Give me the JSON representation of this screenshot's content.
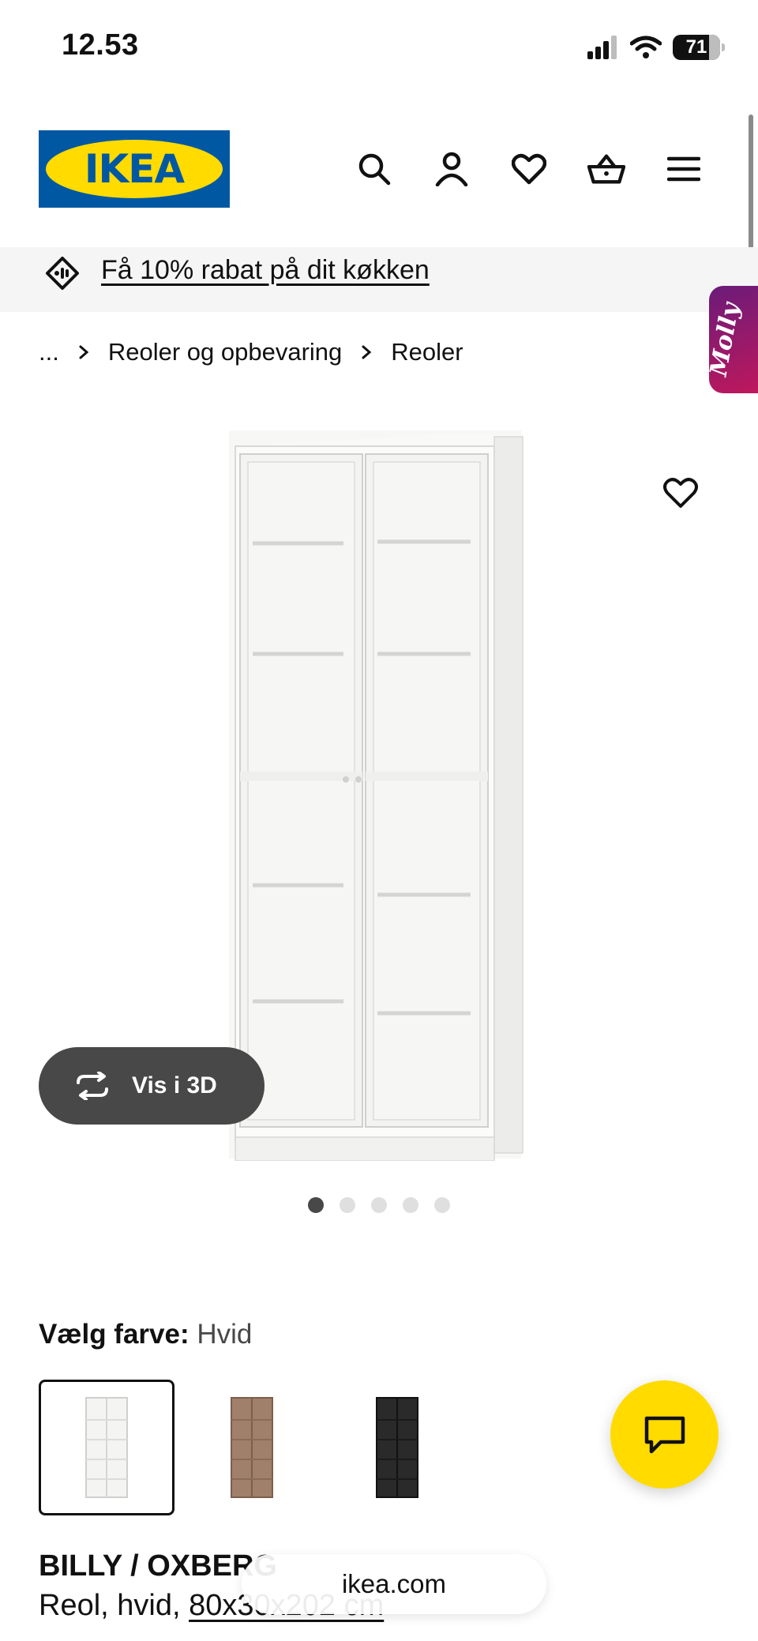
{
  "status_bar": {
    "time": "12.53",
    "battery": "71"
  },
  "header": {
    "logo_text": "IKEA",
    "icons": [
      "search-icon",
      "profile-icon",
      "heart-icon",
      "basket-icon",
      "menu-icon"
    ]
  },
  "promo": {
    "text": "Få 10% rabat på dit køkken"
  },
  "molly": {
    "label": "Molly"
  },
  "breadcrumb": {
    "items": [
      "...",
      "Reoler og opbevaring",
      "Reoler"
    ]
  },
  "gallery": {
    "view_3d_label": "Vis i 3D",
    "slide_count": 5,
    "active_slide": 1
  },
  "color_select": {
    "label": "Vælg farve:",
    "value": "Hvid",
    "options": [
      {
        "name": "Hvid",
        "color": "#f4f4f2",
        "selected": true
      },
      {
        "name": "Eg",
        "color": "#a0806a",
        "selected": false
      },
      {
        "name": "Sort",
        "color": "#2a2a2a",
        "selected": false
      }
    ]
  },
  "product": {
    "name": "BILLY / OXBERG",
    "desc_prefix": "Reol, hvid, ",
    "dimensions": "80x30x202 cm"
  },
  "url_bar": {
    "domain": "ikea.com"
  },
  "colors": {
    "ikea_blue": "#0058a3",
    "ikea_yellow": "#ffdb00",
    "button_dark": "#484848"
  }
}
